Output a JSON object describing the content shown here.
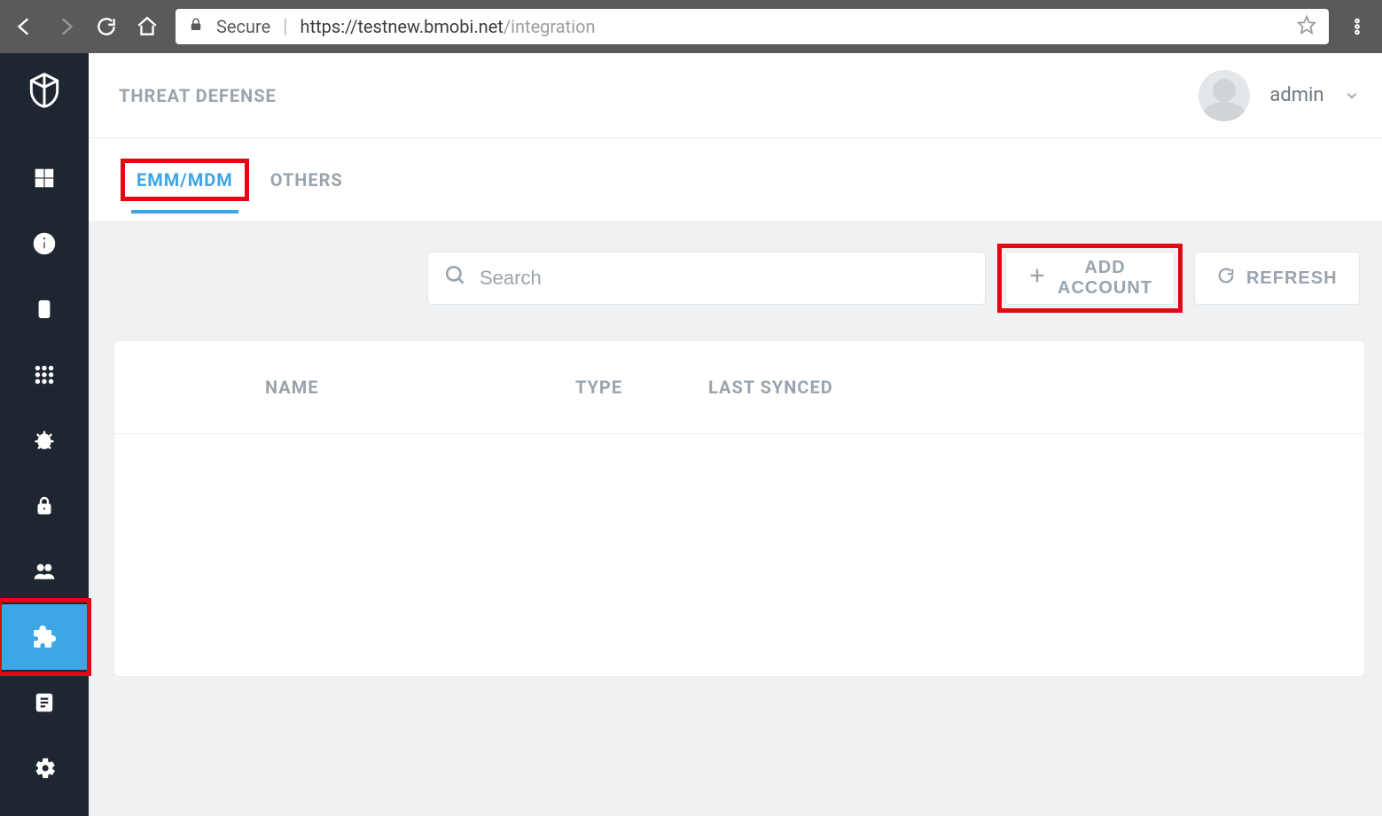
{
  "browser": {
    "secure_label": "Secure",
    "url_host": "https://testnew.bmobi.net",
    "url_path": "/integration"
  },
  "header": {
    "title": "THREAT DEFENSE",
    "user": "admin"
  },
  "tabs": [
    {
      "label": "EMM/MDM",
      "active": true
    },
    {
      "label": "OTHERS",
      "active": false
    }
  ],
  "toolbar": {
    "search_placeholder": "Search",
    "add_account_label": "ADD ACCOUNT",
    "refresh_label": "REFRESH"
  },
  "table": {
    "columns": [
      "NAME",
      "TYPE",
      "LAST SYNCED"
    ],
    "rows": []
  },
  "sidebar": {
    "items": [
      "dashboard",
      "info",
      "devices",
      "apps-grid",
      "threats",
      "security",
      "users",
      "integrations",
      "reports",
      "settings"
    ],
    "active_index": 7
  }
}
